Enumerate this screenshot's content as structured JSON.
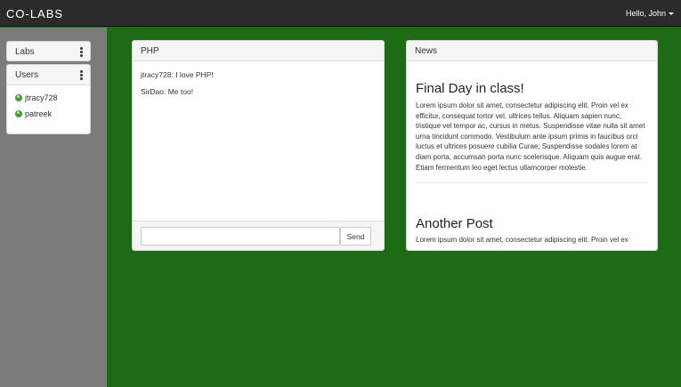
{
  "navbar": {
    "brand": "CO-LABS",
    "user_greeting": "Hello, John"
  },
  "sidebar": {
    "labs_title": "Labs",
    "users_title": "Users",
    "users": [
      "jtracy728",
      "patreek"
    ]
  },
  "chat": {
    "title": "PHP",
    "messages": [
      "jtracy728: I love PHP!",
      "SirDao: Me too!"
    ],
    "input_value": "",
    "send_label": "Send"
  },
  "news": {
    "title": "News",
    "posts": [
      {
        "title": "Final Day in class!",
        "body": "Lorem ipsum dolor sit amet, consectetur adipiscing elit. Proin vel ex efficitur, consequat tortor vel, ultrices tellus. Aliquam sapien nunc, tristique vel tempor ac, cursus in metus. Suspendisse vitae nulla sit amet urna tincidunt commodo. Vestibulum ante ipsum primis in faucibus orci luctus et ultrices posuere cubilia Curae; Suspendisse sodales lorem at diam porta, accumsan porta nunc scelerisque. Aliquam quis augue erat. Etiam fermentum leo eget lectus ullamcorper molestie."
      },
      {
        "title": "Another Post",
        "body": "Lorem ipsum dolor sit amet, consectetur adipiscing elit. Proin vel ex"
      }
    ]
  },
  "colors": {
    "background": "#1e6b15",
    "sidebar": "#7b7b7b",
    "navbar": "#2b2b2b"
  }
}
